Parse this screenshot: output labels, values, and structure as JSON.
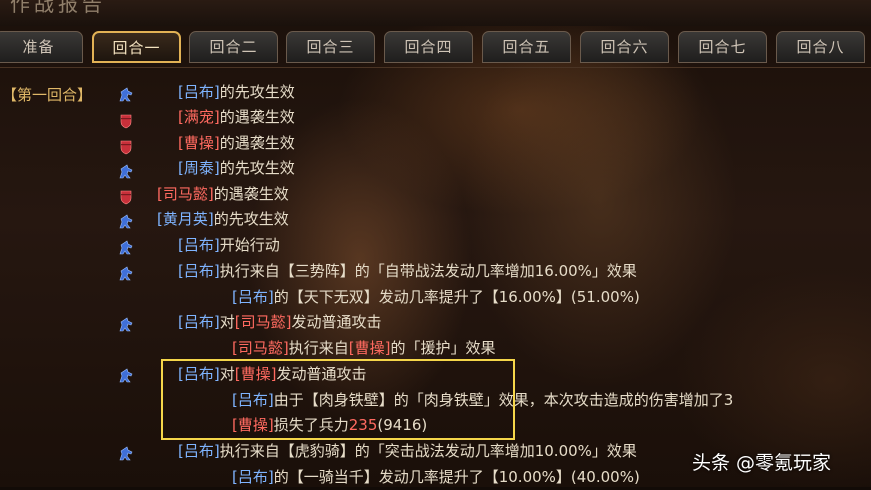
{
  "window": {
    "title": "作战报告"
  },
  "tabs": [
    "准备",
    "回合一",
    "回合二",
    "回合三",
    "回合四",
    "回合五",
    "回合六",
    "回合七",
    "回合八"
  ],
  "active_tab": "回合一",
  "round_label": "【第一回合】",
  "colors": {
    "ally": "#7fb4ff",
    "enemy": "#ff6a60",
    "accent": "#e2b255",
    "highlight": "#f5d64a"
  },
  "icons": {
    "first_strike": "horse-icon",
    "ambush": "shield-icon"
  },
  "log": [
    {
      "icon": "horse-icon",
      "parts": [
        [
          "blue",
          "[吕布]"
        ],
        [
          "n",
          "的先攻生效"
        ]
      ]
    },
    {
      "icon": "shield-icon",
      "parts": [
        [
          "red",
          "[满宠]"
        ],
        [
          "n",
          "的遇袭生效"
        ]
      ]
    },
    {
      "icon": "shield-icon",
      "parts": [
        [
          "red",
          "[曹操]"
        ],
        [
          "n",
          "的遇袭生效"
        ]
      ]
    },
    {
      "icon": "horse-icon",
      "parts": [
        [
          "blue",
          "[周泰]"
        ],
        [
          "n",
          "的先攻生效"
        ]
      ]
    },
    {
      "icon": "shield-icon",
      "parts": [
        [
          "red",
          "[司马懿]"
        ],
        [
          "n",
          "的遇袭生效"
        ]
      ]
    },
    {
      "icon": "horse-icon",
      "parts": [
        [
          "blue",
          "[黄月英]"
        ],
        [
          "n",
          "的先攻生效"
        ]
      ]
    },
    {
      "icon": "horse-icon",
      "parts": [
        [
          "blue",
          "[吕布]"
        ],
        [
          "n",
          "开始行动"
        ]
      ]
    },
    {
      "icon": "horse-icon",
      "parts": [
        [
          "blue",
          "[吕布]"
        ],
        [
          "n",
          "执行来自【三势阵】的「自带战法发动几率增加16.00%」效果"
        ]
      ]
    },
    {
      "icon": "",
      "parts": [
        [
          "blue",
          "[吕布]"
        ],
        [
          "n",
          "的【天下无双】发动几率提升了【16.00%】(51.00%)"
        ]
      ]
    },
    {
      "icon": "horse-icon",
      "parts": [
        [
          "blue",
          "[吕布]"
        ],
        [
          "n",
          "对"
        ],
        [
          "red",
          "[司马懿]"
        ],
        [
          "n",
          "发动普通攻击"
        ]
      ]
    },
    {
      "icon": "",
      "parts": [
        [
          "red",
          "[司马懿]"
        ],
        [
          "n",
          "执行来自"
        ],
        [
          "red",
          "[曹操]"
        ],
        [
          "n",
          "的「援护」效果"
        ]
      ]
    },
    {
      "icon": "horse-icon",
      "parts": [
        [
          "blue",
          "[吕布]"
        ],
        [
          "n",
          "对"
        ],
        [
          "red",
          "[曹操]"
        ],
        [
          "n",
          "发动普通攻击"
        ]
      ]
    },
    {
      "icon": "",
      "parts": [
        [
          "blue",
          "[吕布]"
        ],
        [
          "n",
          "由于【肉身铁壁】的「肉身铁壁」效果，本次攻击造成的伤害增加了3"
        ]
      ]
    },
    {
      "icon": "",
      "parts": [
        [
          "red",
          "[曹操]"
        ],
        [
          "n",
          "损失了兵力"
        ],
        [
          "red",
          "235"
        ],
        [
          "n",
          "(9416)"
        ]
      ]
    },
    {
      "icon": "horse-icon",
      "parts": [
        [
          "blue",
          "[吕布]"
        ],
        [
          "n",
          "执行来自【虎豹骑】的「突击战法发动几率增加10.00%」效果"
        ]
      ]
    },
    {
      "icon": "",
      "parts": [
        [
          "blue",
          "[吕布]"
        ],
        [
          "n",
          "的【一骑当千】发动几率提升了【10.00%】(40.00%)"
        ]
      ]
    }
  ],
  "watermark": "头条 @零氪玩家"
}
